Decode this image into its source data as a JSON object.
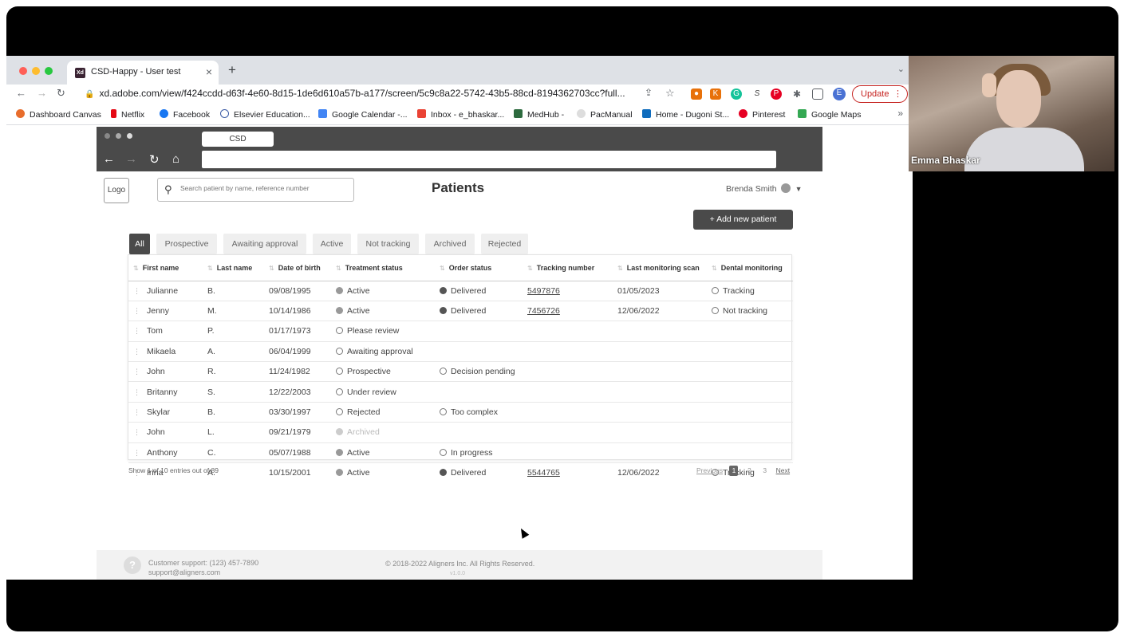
{
  "browser": {
    "tab_title": "CSD-Happy - User test",
    "tab_favicon": "Xd",
    "url": "xd.adobe.com/view/f424ccdd-d63f-4e60-8d15-1de6d610a57b-a177/screen/5c9c8a22-5742-43b5-88cd-8194362703cc?full...",
    "update_label": "Update",
    "profile_initial": "E",
    "bookmarks": [
      "Dashboard Canvas",
      "Netflix",
      "Facebook",
      "Elsevier Education...",
      "Google Calendar -...",
      "Inbox - e_bhaskar...",
      "MedHub -",
      "PacManual",
      "Home - Dugoni St...",
      "Pinterest",
      "Google Maps"
    ]
  },
  "xd": {
    "tab_label": "CSD"
  },
  "app": {
    "logo": "Logo",
    "search_placeholder": "Search patient by name, reference number",
    "title": "Patients",
    "user_name": "Brenda Smith",
    "add_button": "+ Add new patient",
    "filters": [
      "All",
      "Prospective",
      "Awaiting approval",
      "Active",
      "Not tracking",
      "Archived",
      "Rejected"
    ],
    "active_filter": "All",
    "columns": [
      "First name",
      "Last name",
      "Date of birth",
      "Treatment status",
      "Order status",
      "Tracking number",
      "Last monitoring scan",
      "Dental monitoring"
    ],
    "rows": [
      {
        "first": "Julianne",
        "last": "B.",
        "dob": "09/08/1995",
        "treatment": "Active",
        "order": "Delivered",
        "tracking": "5497876",
        "scan": "01/05/2023",
        "dental": "Tracking"
      },
      {
        "first": "Jenny",
        "last": "M.",
        "dob": "10/14/1986",
        "treatment": "Active",
        "order": "Delivered",
        "tracking": "7456726",
        "scan": "12/06/2022",
        "dental": "Not tracking"
      },
      {
        "first": "Tom",
        "last": "P.",
        "dob": "01/17/1973",
        "treatment": "Please review",
        "order": "",
        "tracking": "",
        "scan": "",
        "dental": ""
      },
      {
        "first": "Mikaela",
        "last": "A.",
        "dob": "06/04/1999",
        "treatment": "Awaiting approval",
        "order": "",
        "tracking": "",
        "scan": "",
        "dental": ""
      },
      {
        "first": "John",
        "last": "R.",
        "dob": "11/24/1982",
        "treatment": "Prospective",
        "order": "Decision pending",
        "tracking": "",
        "scan": "",
        "dental": ""
      },
      {
        "first": "Britanny",
        "last": "S.",
        "dob": "12/22/2003",
        "treatment": "Under review",
        "order": "",
        "tracking": "",
        "scan": "",
        "dental": ""
      },
      {
        "first": "Skylar",
        "last": "B.",
        "dob": "03/30/1997",
        "treatment": "Rejected",
        "order": "Too complex",
        "tracking": "",
        "scan": "",
        "dental": ""
      },
      {
        "first": "John",
        "last": "L.",
        "dob": "09/21/1979",
        "treatment": "Archived",
        "order": "",
        "tracking": "",
        "scan": "",
        "dental": ""
      },
      {
        "first": "Anthony",
        "last": "C.",
        "dob": "05/07/1988",
        "treatment": "Active",
        "order": "In progress",
        "tracking": "",
        "scan": "",
        "dental": ""
      },
      {
        "first": "Irina",
        "last": "A.",
        "dob": "10/15/2001",
        "treatment": "Active",
        "order": "Delivered",
        "tracking": "5544765",
        "scan": "12/06/2022",
        "dental": "Tracking"
      }
    ],
    "entries_text": "Show 1 of 10 entries out of 89",
    "pager": {
      "previous": "Previous",
      "pages": [
        "1",
        "2",
        "3"
      ],
      "current": "1",
      "next": "Next"
    },
    "footer": {
      "support_line1": "Customer support: (123) 457-7890",
      "support_line2": "support@aligners.com",
      "copyright": "© 2018-2022 Aligners Inc. All Rights Reserved.",
      "version": "v1.0.0"
    }
  },
  "webcam": {
    "name": "Emma Bhaskar"
  },
  "colors": {
    "dark": "#4a4a4a",
    "update_red": "#c5221f"
  }
}
